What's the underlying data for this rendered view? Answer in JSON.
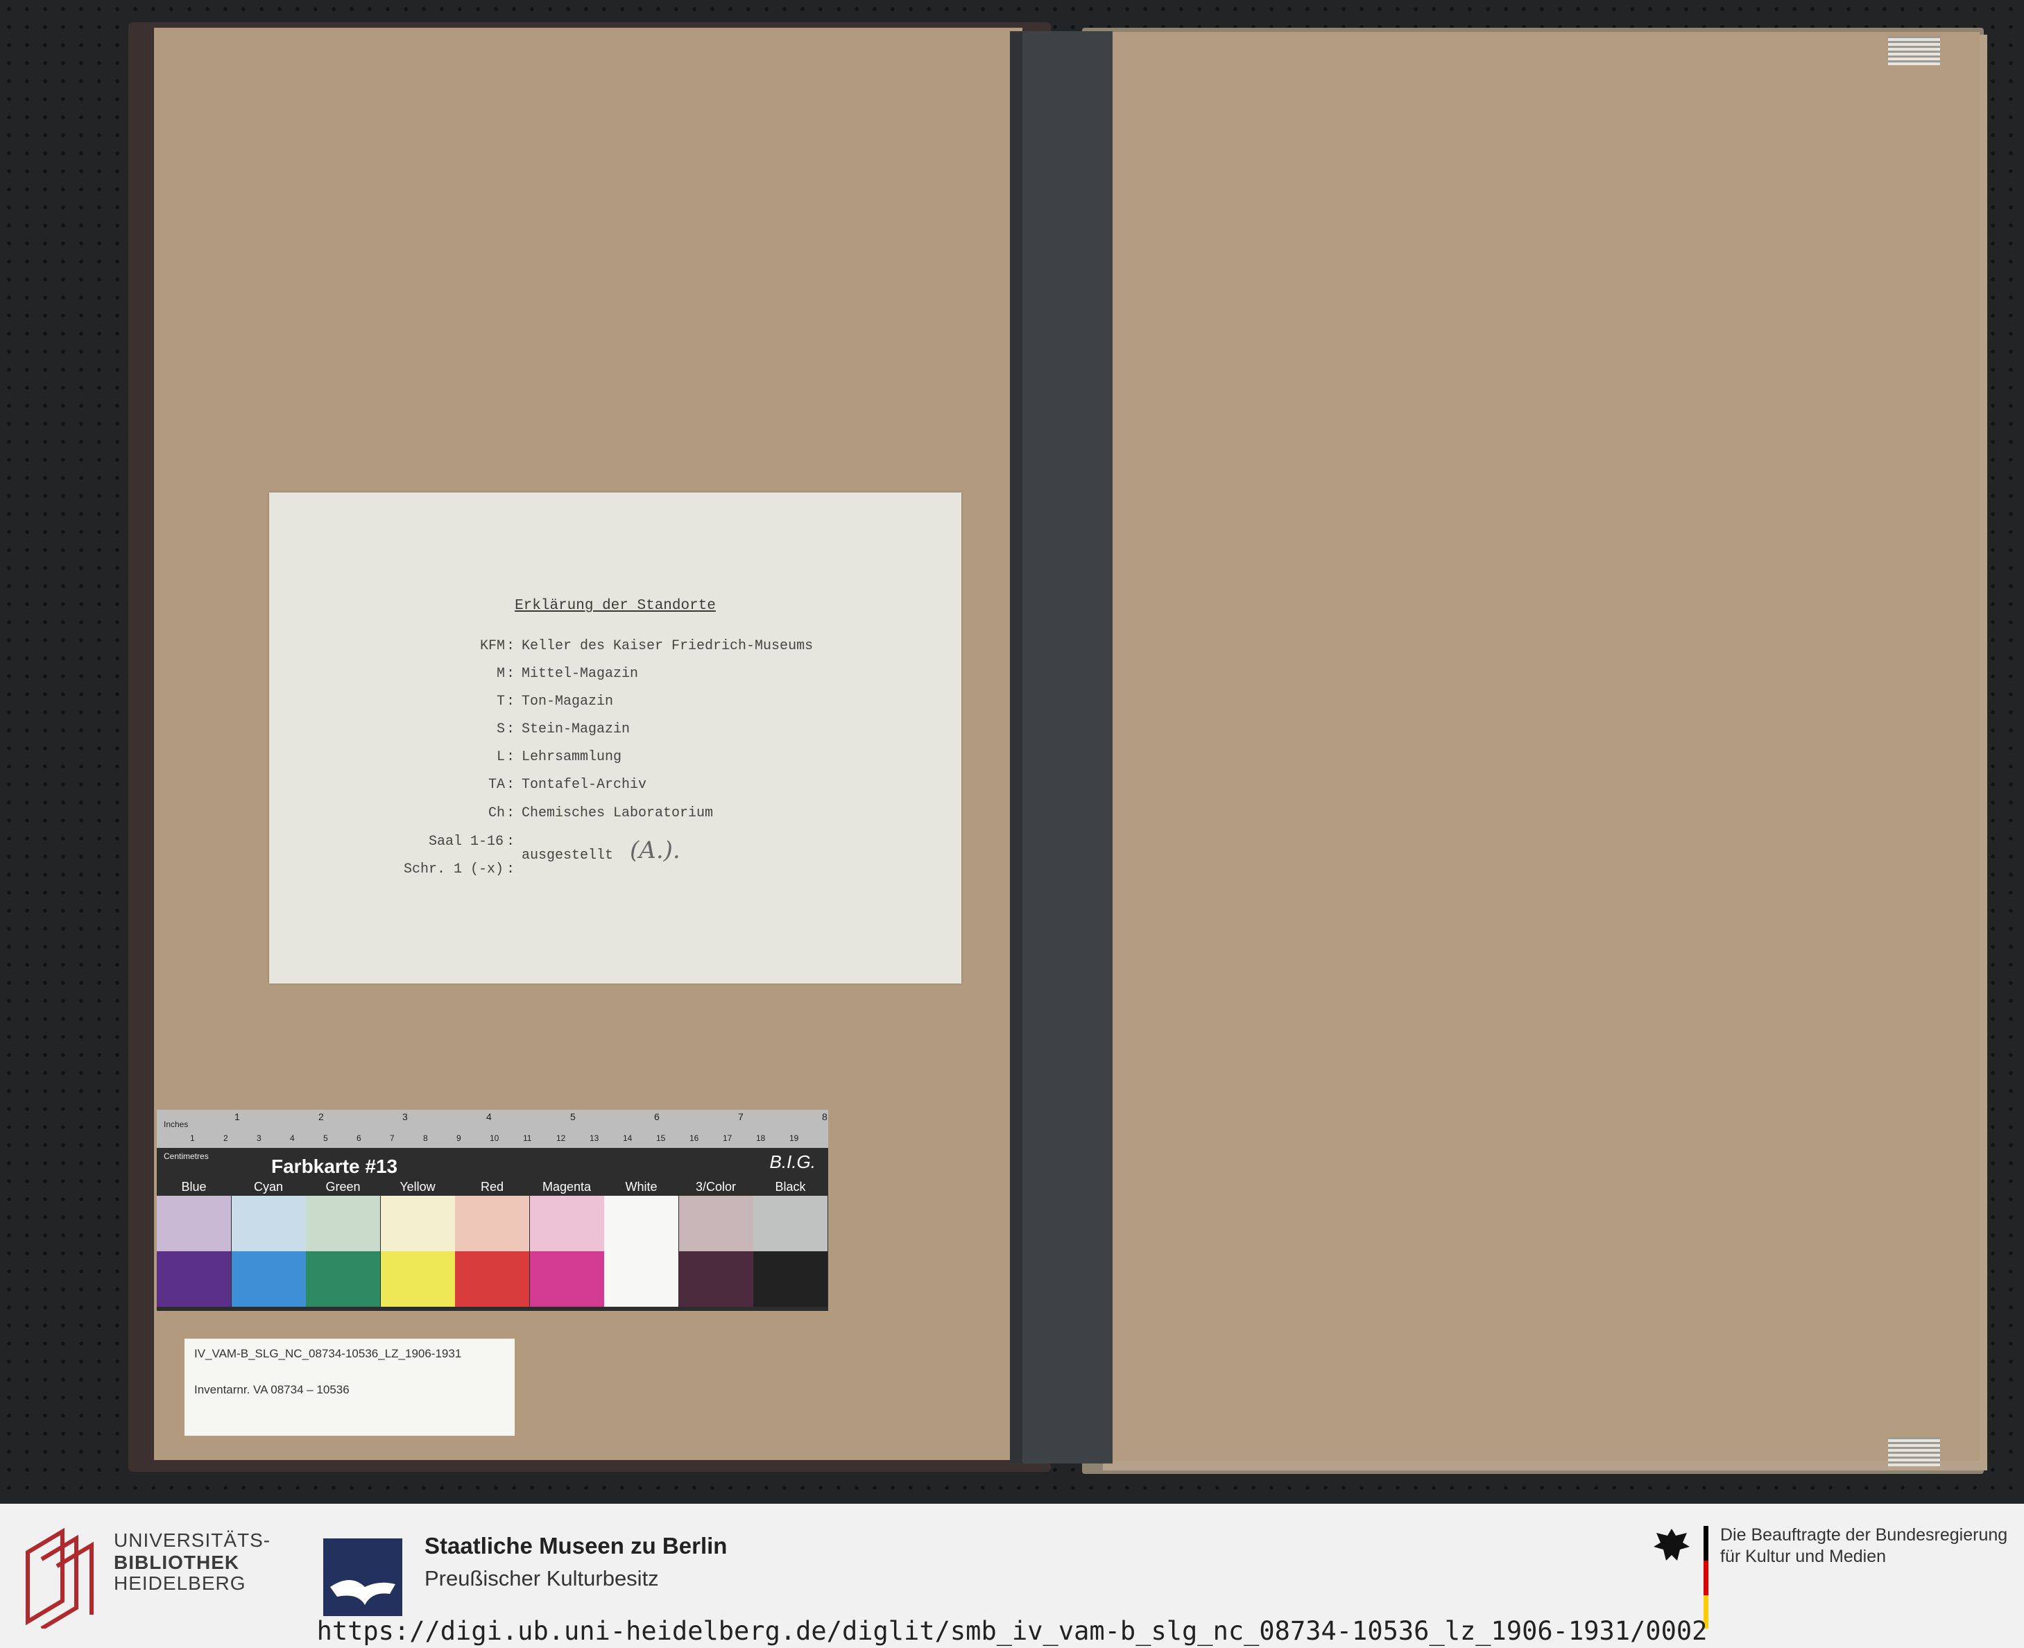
{
  "card": {
    "title": "Erklärung der Standorte",
    "entries": [
      {
        "code": "KFM",
        "desc": "Keller des Kaiser Friedrich-Museums"
      },
      {
        "code": "M",
        "desc": "Mittel-Magazin"
      },
      {
        "code": "T",
        "desc": "Ton-Magazin"
      },
      {
        "code": "S",
        "desc": "Stein-Magazin"
      },
      {
        "code": "L",
        "desc": "Lehrsammlung"
      },
      {
        "code": "TA",
        "desc": "Tontafel-Archiv"
      },
      {
        "code": "Ch",
        "desc": "Chemisches Laboratorium"
      }
    ],
    "saal": "Saal 1-16",
    "schr": "Schr. 1 (-x)",
    "colon": ":",
    "ausgestellt": "ausgestellt",
    "hand": "(A.)."
  },
  "target": {
    "title": "Farbkarte #13",
    "brand": "B.I.G.",
    "inches_label": "Inches",
    "cm_label": "Centimetres",
    "inch_numbers": [
      "1",
      "2",
      "3",
      "4",
      "5",
      "6",
      "7",
      "8"
    ],
    "cm_numbers": [
      "1",
      "2",
      "3",
      "4",
      "5",
      "6",
      "7",
      "8",
      "9",
      "10",
      "11",
      "12",
      "13",
      "14",
      "15",
      "16",
      "17",
      "18",
      "19"
    ],
    "swatches": [
      {
        "name": "Blue",
        "light": "#c9b9d5",
        "dark": "#5b3088"
      },
      {
        "name": "Cyan",
        "light": "#c9dcea",
        "dark": "#3f8fd6"
      },
      {
        "name": "Green",
        "light": "#c9dccb",
        "dark": "#2e8a62"
      },
      {
        "name": "Yellow",
        "light": "#f4efcf",
        "dark": "#eee856"
      },
      {
        "name": "Red",
        "light": "#efc7b8",
        "dark": "#d93c3c"
      },
      {
        "name": "Magenta",
        "light": "#ecc2d4",
        "dark": "#d33a92"
      },
      {
        "name": "White",
        "light": "#f7f7f5",
        "dark": "#f7f7f5"
      },
      {
        "name": "3/Color",
        "light": "#c9b6b8",
        "dark": "#4c2b3e"
      },
      {
        "name": "Black",
        "light": "#c0c1c1",
        "dark": "#222222"
      }
    ]
  },
  "label": {
    "line1": "IV_VAM-B_SLG_NC_08734-10536_LZ_1906-1931",
    "line2": "Inventarnr. VA 08734 – 10536"
  },
  "footer": {
    "ub": {
      "line1": "UNIVERSITÄTS-",
      "line2": "BIBLIOTHEK",
      "line3": "HEIDELBERG",
      "logo_icon": "ub-heidelberg-logo-icon"
    },
    "smb": {
      "title": "Staatliche Museen zu Berlin",
      "subtitle": "Preußischer Kulturbesitz",
      "logo_icon": "smb-eagle-logo-icon"
    },
    "bkm": {
      "line1": "Die Beauftragte der Bundesregierung",
      "line2": "für Kultur und Medien",
      "logo_icon": "federal-eagle-icon"
    },
    "url": "https://digi.ub.uni-heidelberg.de/diglit/smb_iv_vam-b_slg_nc_08734-10536_lz_1906-1931/0002"
  }
}
